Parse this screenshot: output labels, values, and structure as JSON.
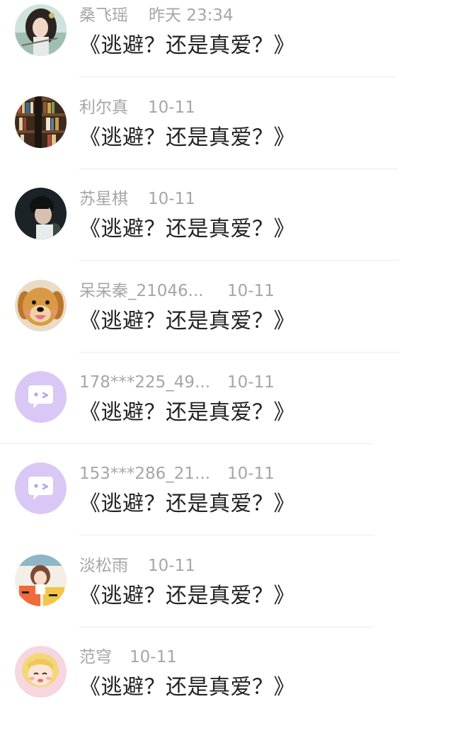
{
  "colors": {
    "name_text": "#a6a6a6",
    "message_text": "#222222",
    "divider": "#ededed",
    "default_avatar_bg": "#d9c8f5"
  },
  "comments": [
    {
      "name": "桑飞瑶",
      "time": "昨天 23:34",
      "text": "《逃避？还是真爱？》",
      "avatar": "anime-girl-avatar"
    },
    {
      "name": "利尔真",
      "time": "10-11",
      "text": "《逃避？还是真爱？》",
      "avatar": "bookshelf-avatar"
    },
    {
      "name": "苏星棋",
      "time": "10-11",
      "text": "《逃避？还是真爱？》",
      "avatar": "boy-portrait-avatar"
    },
    {
      "name": "呆呆秦_21046...",
      "time": "10-11",
      "text": "《逃避？还是真爱？》",
      "avatar": "puppy-avatar"
    },
    {
      "name": "178***225_49...",
      "time": "10-11",
      "text": "《逃避？还是真爱？》",
      "avatar": "default-chat-bubble-avatar"
    },
    {
      "name": "153***286_21...",
      "time": "10-11",
      "text": "《逃避？还是真爱？》",
      "avatar": "default-chat-bubble-avatar"
    },
    {
      "name": "淡松雨",
      "time": "10-11",
      "text": "《逃避？还是真爱？》",
      "avatar": "illustrated-girl-avatar"
    },
    {
      "name": "范穹",
      "time": "10-11",
      "text": "《逃避？还是真爱？》",
      "avatar": "cartoon-blonde-girl-avatar"
    }
  ]
}
